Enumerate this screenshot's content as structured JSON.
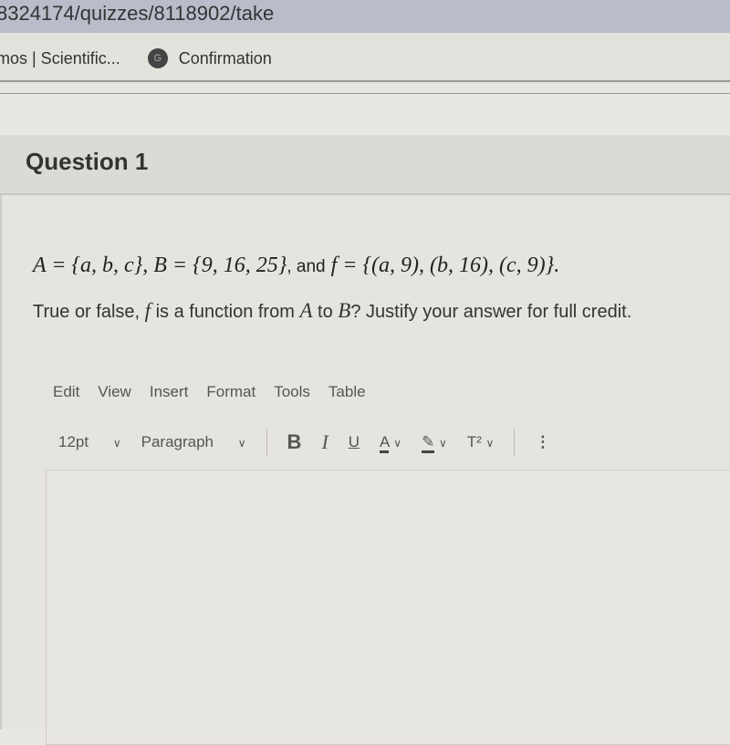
{
  "browser": {
    "url": "8324174/quizzes/8118902/take",
    "bookmarks": [
      {
        "label": "mos | Scientific..."
      },
      {
        "label": "Confirmation",
        "icon": "google-icon"
      }
    ]
  },
  "question": {
    "title": "Question 1",
    "statement": {
      "a": "A = {a, b, c}, B = {9, 16, 25}",
      "and": ", and",
      "f": "f = {(a, 9), (b, 16), (c, 9)}."
    },
    "prompt": {
      "p1": "True or false, ",
      "f": "f",
      "p2": " is a function from ",
      "A": "A",
      "p3": " to ",
      "B": "B",
      "p4": "? Justify your answer for full credit."
    }
  },
  "editor": {
    "menu": [
      "Edit",
      "View",
      "Insert",
      "Format",
      "Tools",
      "Table"
    ],
    "font_size": "12pt",
    "block": "Paragraph",
    "bold": "B",
    "italic": "I",
    "underline": "U",
    "text_color": "A",
    "superscript": "T²",
    "more": "⋮",
    "chevron": "∨"
  }
}
